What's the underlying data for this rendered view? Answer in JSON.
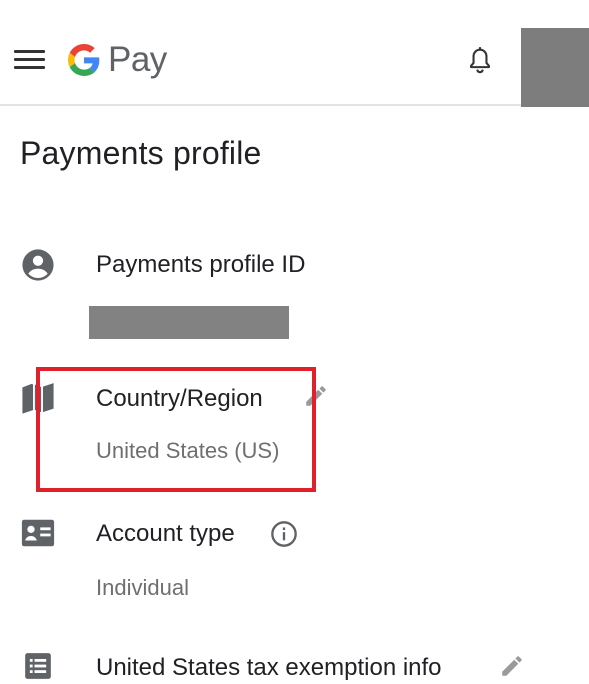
{
  "header": {
    "menu_icon": "hamburger-menu-icon",
    "logo_icon": "google-g-logo",
    "logo_text": "Pay",
    "notification_icon": "bell-icon"
  },
  "page": {
    "title": "Payments profile"
  },
  "profile_id": {
    "icon": "account-circle-icon",
    "label": "Payments profile ID",
    "value_redacted": true
  },
  "country_region": {
    "icon": "map-icon",
    "label": "Country/Region",
    "value": "United States (US)",
    "edit_icon": "pencil-icon",
    "highlight_color": "#e0202a"
  },
  "account_type": {
    "icon": "contact-card-icon",
    "label": "Account type",
    "info_icon": "info-icon",
    "value": "Individual"
  },
  "tax_exemption": {
    "icon": "list-document-icon",
    "label": "United States tax exemption info",
    "edit_icon": "pencil-icon"
  },
  "colors": {
    "primary_text": "#202124",
    "secondary_text": "#6f6f6f",
    "icon": "#5f6368",
    "redaction": "#7d7d7d"
  }
}
